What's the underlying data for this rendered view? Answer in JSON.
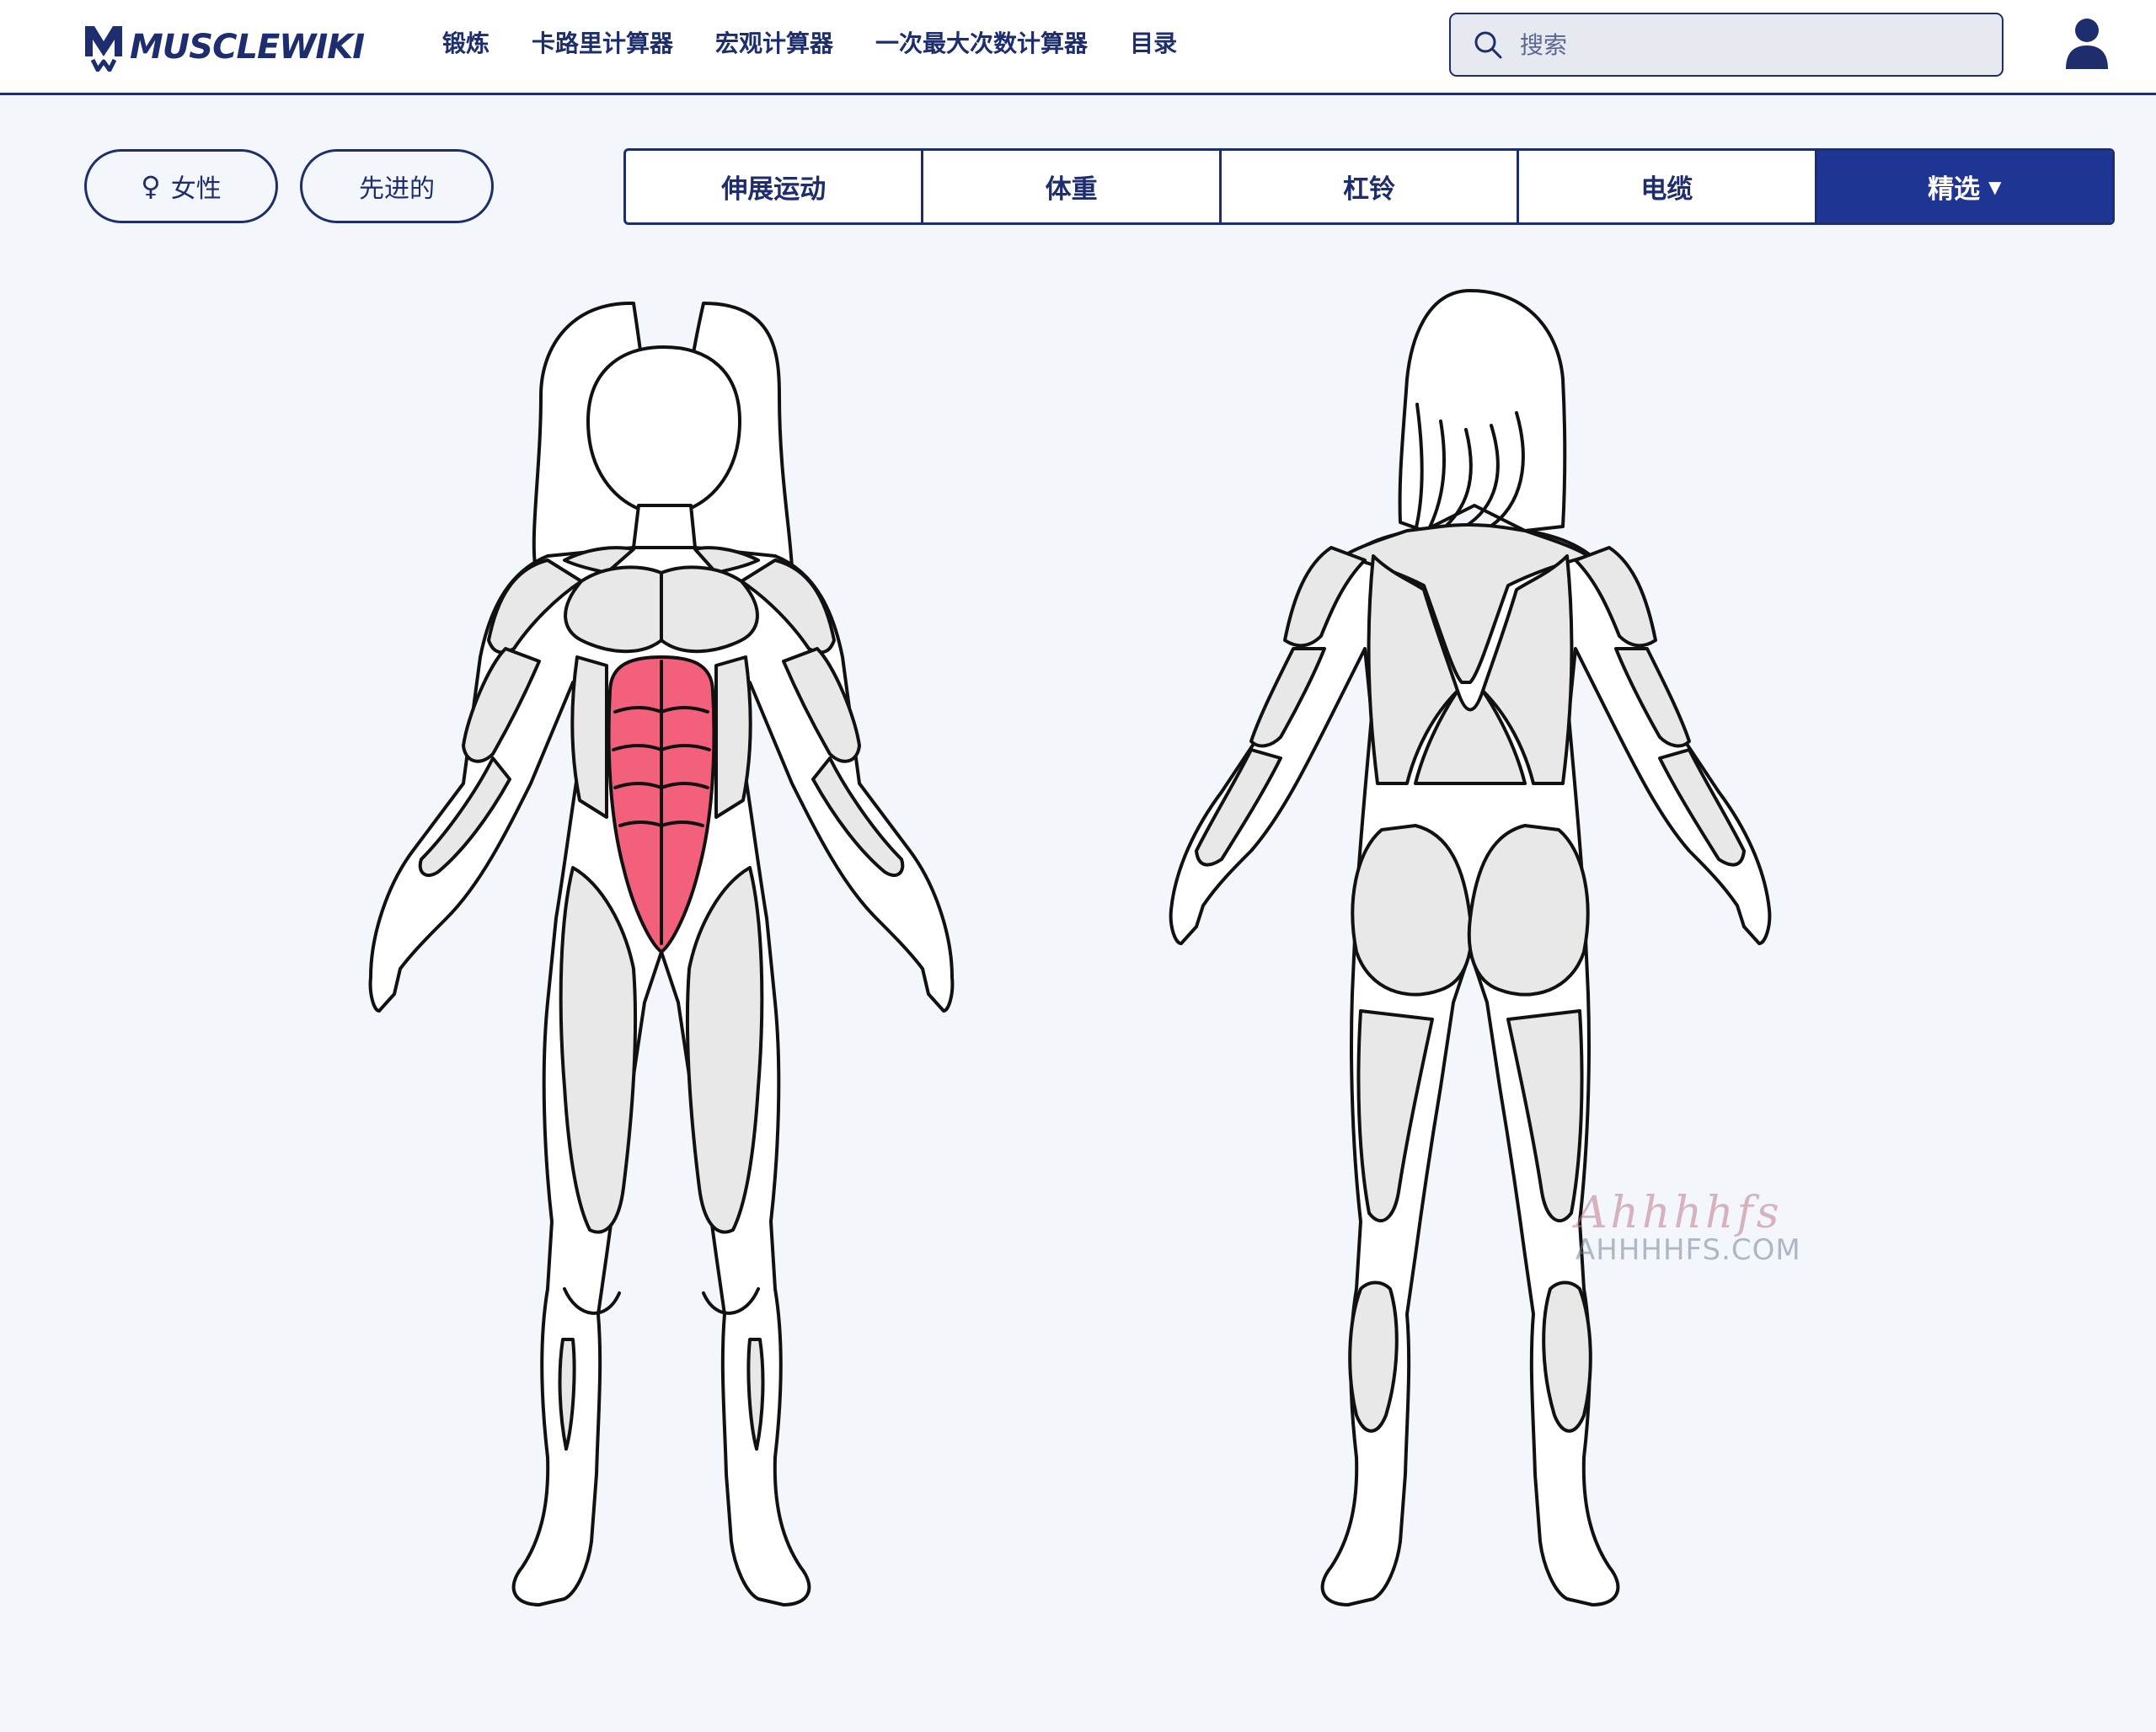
{
  "brand": {
    "name": "MUSCLEWIKI"
  },
  "nav": {
    "items": [
      {
        "label": "锻炼"
      },
      {
        "label": "卡路里计算器"
      },
      {
        "label": "宏观计算器"
      },
      {
        "label": "一次最大次数计算器"
      },
      {
        "label": "目录"
      }
    ]
  },
  "search": {
    "placeholder": "搜索",
    "value": ""
  },
  "filters": {
    "gender_symbol": "♀",
    "gender": "女性",
    "level": "先进的"
  },
  "equipment": {
    "tabs": [
      {
        "label": "伸展运动",
        "active": false
      },
      {
        "label": "体重",
        "active": false
      },
      {
        "label": "杠铃",
        "active": false
      },
      {
        "label": "电缆",
        "active": false
      },
      {
        "label": "精选",
        "active": true,
        "dropdown": true
      }
    ]
  },
  "body_map": {
    "views": [
      "front",
      "back"
    ],
    "selected_muscle": "abdominals",
    "highlight_color": "#f2607c",
    "muscle_color": "#e8e8e8"
  },
  "watermark": {
    "script": "Ahhhhfs",
    "url": "AHHHHFS.COM"
  },
  "colors": {
    "primary": "#1d2d6e",
    "active_tab": "#1f3594",
    "background": "#f3f7fb"
  }
}
